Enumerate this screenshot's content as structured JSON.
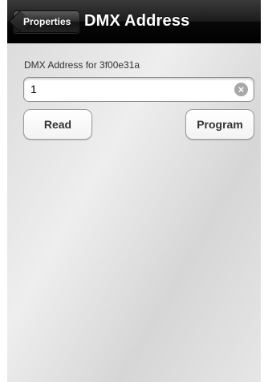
{
  "navbar": {
    "back_label": "Properties",
    "title": "DMX Address"
  },
  "form": {
    "label": "DMX Address for 3f00e31a",
    "address_value": "1",
    "clear_icon": "clear-icon"
  },
  "buttons": {
    "read_label": "Read",
    "program_label": "Program"
  }
}
